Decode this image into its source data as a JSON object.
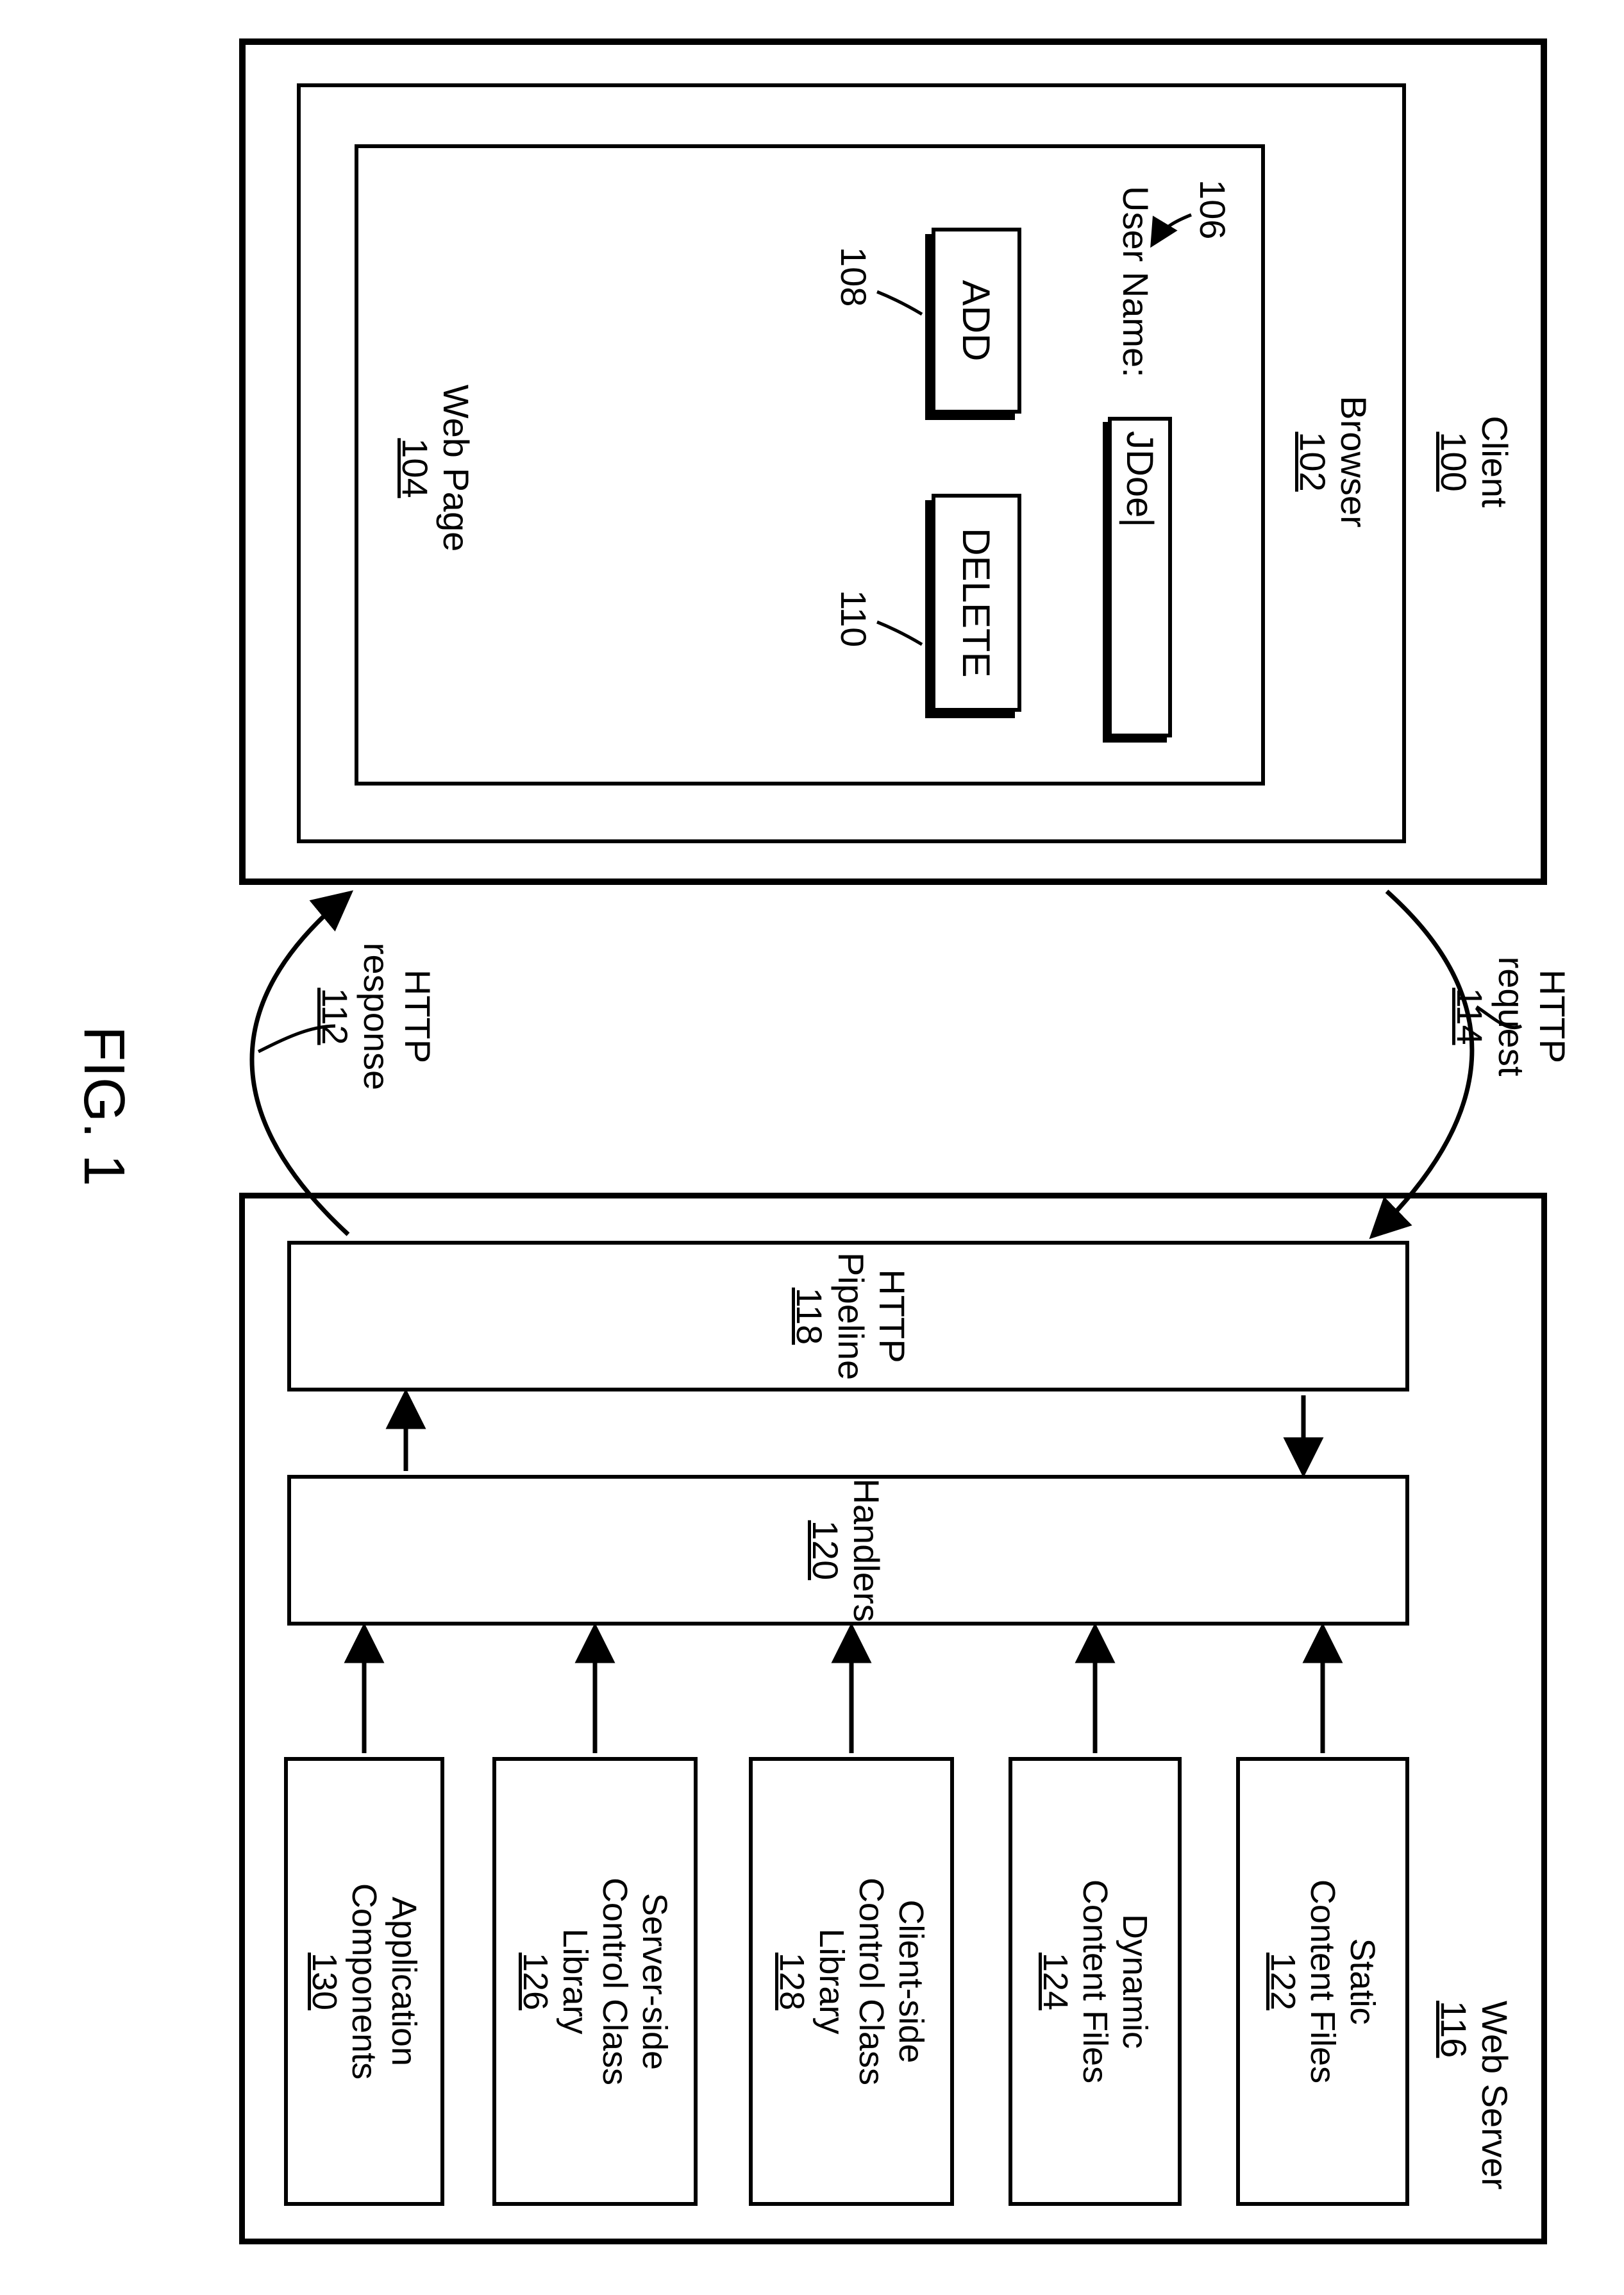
{
  "figure_caption": "FIG. 1",
  "client": {
    "title": "Client",
    "id": "100",
    "browser": {
      "title": "Browser",
      "id": "102",
      "webpage": {
        "title": "Web Page",
        "id": "104",
        "username_label": "User Name:",
        "username_label_id": "106",
        "username_value": "JDoe|",
        "add_btn": "ADD",
        "add_btn_id": "108",
        "delete_btn": "DELETE",
        "delete_btn_id": "110"
      }
    }
  },
  "request_label": "HTTP request",
  "request_id": "114",
  "response_label": "HTTP response",
  "response_id": "112",
  "server": {
    "title": "Web Server",
    "id": "116",
    "pipeline": {
      "title": "HTTP Pipeline",
      "id": "118"
    },
    "handlers": {
      "title": "Handlers",
      "id": "120"
    },
    "components": [
      {
        "line1": "Static",
        "line2": "Content Files",
        "id": "122"
      },
      {
        "line1": "Dynamic",
        "line2": "Content Files",
        "id": "124"
      },
      {
        "line1": "Client-side",
        "line2": "Control Class",
        "line3": "Library",
        "id": "128"
      },
      {
        "line1": "Server-side",
        "line2": "Control Class",
        "line3": "Library",
        "id": "126"
      },
      {
        "line1": "Application",
        "line2": "Components",
        "id": "130"
      }
    ]
  }
}
